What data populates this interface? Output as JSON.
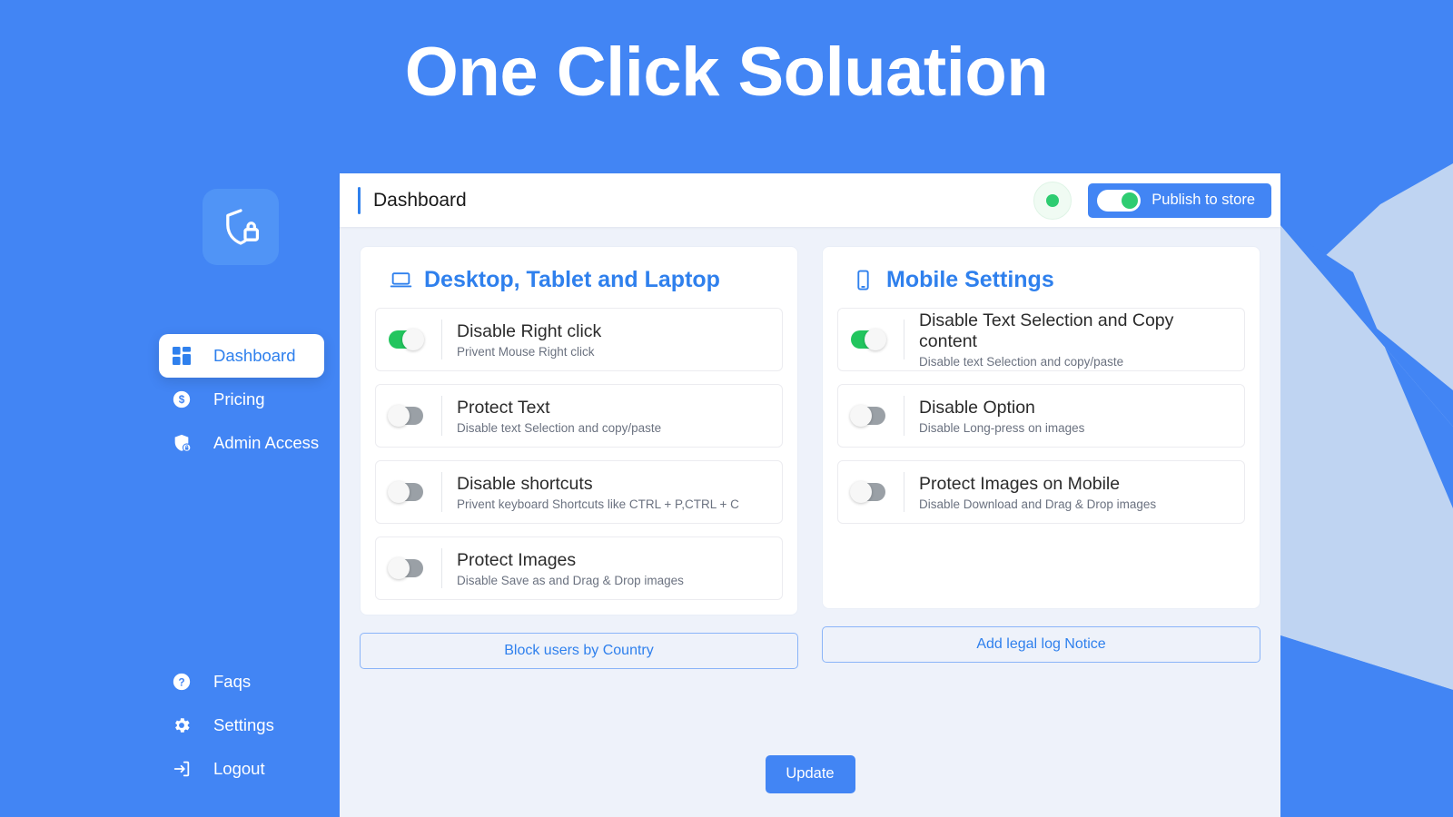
{
  "app": {
    "title": "One Click Soluation",
    "brand_color": "#4285f4",
    "logo_icon": "shield-lock-icon"
  },
  "sidebar": {
    "top_items": [
      {
        "label": "Dashboard",
        "icon": "grid-dashboard-icon",
        "active": true
      },
      {
        "label": "Pricing",
        "icon": "dollar-coin-icon",
        "active": false
      },
      {
        "label": "Admin Access",
        "icon": "shield-lock-badge-icon",
        "active": false
      }
    ],
    "bottom_items": [
      {
        "label": "Faqs",
        "icon": "question-circle-icon"
      },
      {
        "label": "Settings",
        "icon": "gear-icon"
      },
      {
        "label": "Logout",
        "icon": "logout-arrow-icon"
      }
    ]
  },
  "header": {
    "title": "Dashboard",
    "status_dot_color": "#2ecc71",
    "publish_label": "Publish to store",
    "publish_toggle_on": true
  },
  "desktop_card": {
    "title": "Desktop, Tablet and Laptop",
    "icon": "laptop-icon",
    "settings": [
      {
        "title": "Disable Right click",
        "subtitle": "Privent Mouse Right click",
        "enabled": true
      },
      {
        "title": "Protect Text",
        "subtitle": "Disable text Selection and copy/paste",
        "enabled": false
      },
      {
        "title": "Disable shortcuts",
        "subtitle": "Privent keyboard Shortcuts like CTRL + P,CTRL + C",
        "enabled": false
      },
      {
        "title": "Protect Images",
        "subtitle": "Disable Save as and Drag & Drop images",
        "enabled": false
      }
    ],
    "action_label": "Block users by Country"
  },
  "mobile_card": {
    "title": "Mobile Settings",
    "icon": "mobile-phone-icon",
    "settings": [
      {
        "title": "Disable Text Selection and Copy content",
        "subtitle": "Disable text Selection and copy/paste",
        "enabled": true
      },
      {
        "title": "Disable Option",
        "subtitle": "Disable Long-press on images",
        "enabled": false
      },
      {
        "title": "Protect Images on Mobile",
        "subtitle": "Disable Download and Drag & Drop images",
        "enabled": false
      }
    ],
    "action_label": "Add legal log Notice"
  },
  "footer": {
    "update_label": "Update"
  },
  "colors": {
    "accent": "#2f80ed",
    "background": "#4285f4",
    "panel_bg": "#eef2fa",
    "toggle_on": "#22c55e",
    "toggle_off": "#9aa0a6",
    "decor_shape": "#bfd4f2"
  }
}
